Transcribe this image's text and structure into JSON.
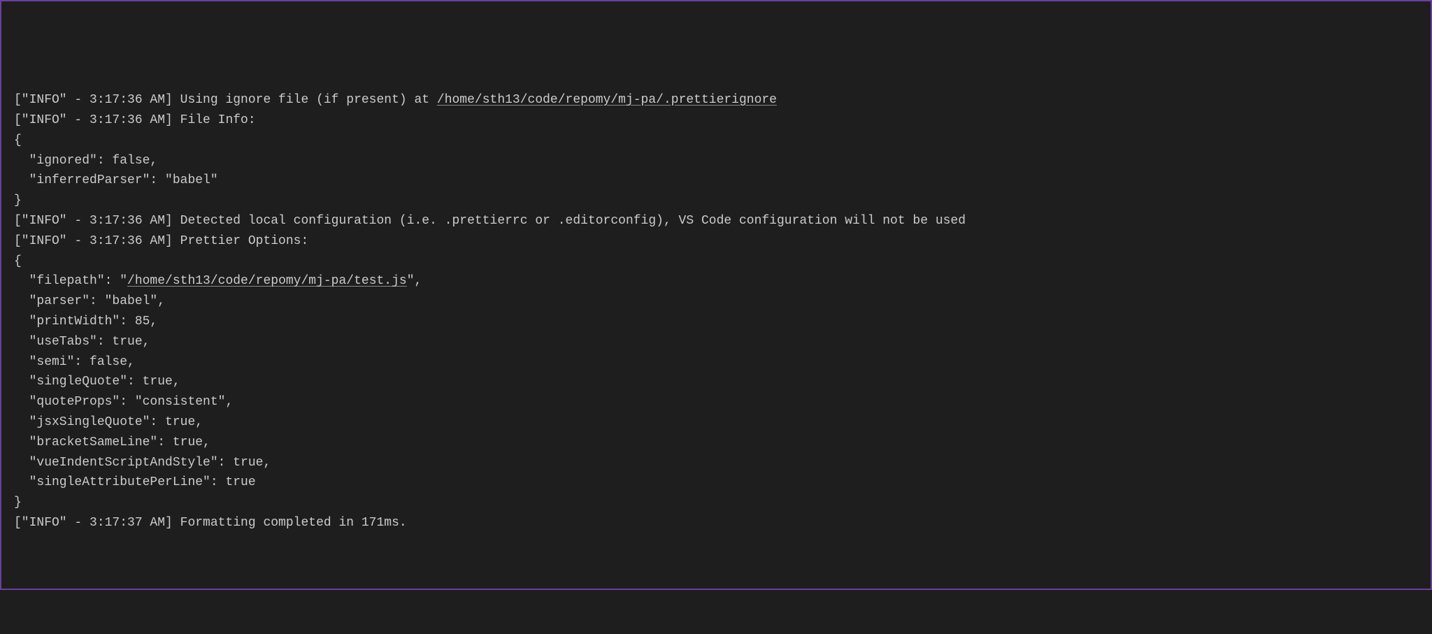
{
  "log": {
    "line1_prefix": "[\"INFO\" - 3:17:36 AM] Using ignore file (if present) at ",
    "line1_path": "/home/sth13/code/repomy/mj-pa/.prettierignore",
    "line2": "[\"INFO\" - 3:17:36 AM] File Info:",
    "line3": "{",
    "line4": "  \"ignored\": false,",
    "line5": "  \"inferredParser\": \"babel\"",
    "line6": "}",
    "line7": "[\"INFO\" - 3:17:36 AM] Detected local configuration (i.e. .prettierrc or .editorconfig), VS Code configuration will not be used",
    "line8": "[\"INFO\" - 3:17:36 AM] Prettier Options:",
    "line9": "{",
    "line10_pre": "  \"filepath\": \"",
    "line10_path": "/home/sth13/code/repomy/mj-pa/test.js",
    "line10_post": "\",",
    "line11": "  \"parser\": \"babel\",",
    "line12": "  \"printWidth\": 85,",
    "line13": "  \"useTabs\": true,",
    "line14": "  \"semi\": false,",
    "line15": "  \"singleQuote\": true,",
    "line16": "  \"quoteProps\": \"consistent\",",
    "line17": "  \"jsxSingleQuote\": true,",
    "line18": "  \"bracketSameLine\": true,",
    "line19": "  \"vueIndentScriptAndStyle\": true,",
    "line20": "  \"singleAttributePerLine\": true",
    "line21": "}",
    "line22": "[\"INFO\" - 3:17:37 AM] Formatting completed in 171ms."
  }
}
